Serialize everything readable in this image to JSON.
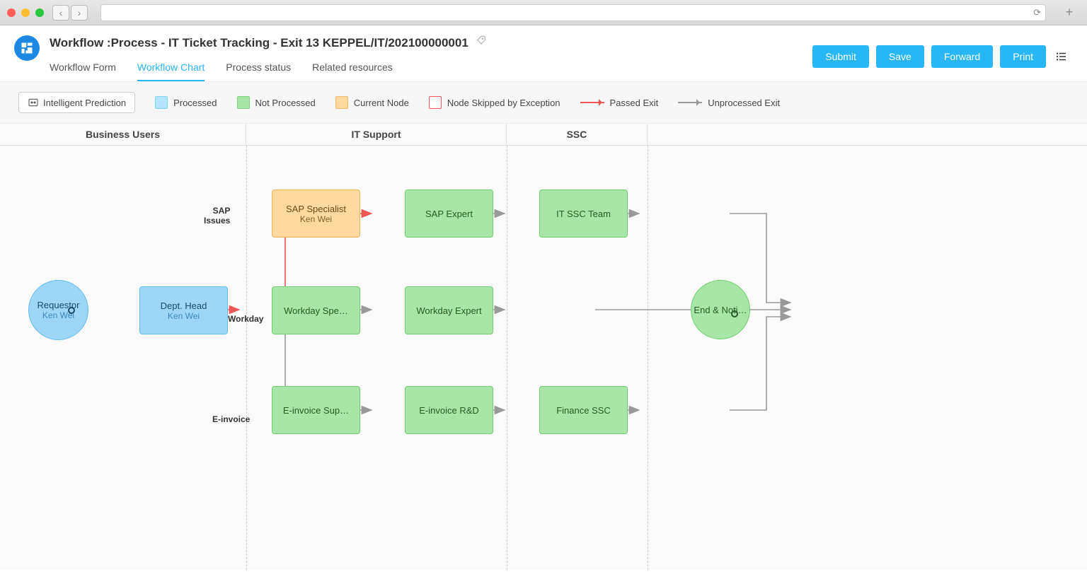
{
  "page_title": "Workflow :Process - IT Ticket Tracking - Exit 13 KEPPEL/IT/202100000001",
  "tabs": [
    "Workflow Form",
    "Workflow Chart",
    "Process status",
    "Related resources"
  ],
  "active_tab": "Workflow Chart",
  "actions": {
    "submit": "Submit",
    "save": "Save",
    "forward": "Forward",
    "print": "Print"
  },
  "prediction_btn": "Intelligent Prediction",
  "legend": {
    "processed": "Processed",
    "not_processed": "Not Processed",
    "current_node": "Current Node",
    "skipped": "Node Skipped by Exception",
    "passed_exit": "Passed Exit",
    "unprocessed_exit": "Unprocessed Exit"
  },
  "lanes": [
    "Business Users",
    "IT Support",
    "SSC"
  ],
  "chart_data": {
    "type": "flowchart",
    "swimlanes": {
      "Business Users": {
        "x_range": [
          0,
          348
        ]
      },
      "IT Support": {
        "x_range": [
          348,
          716
        ]
      },
      "SSC": {
        "x_range": [
          716,
          915
        ]
      }
    },
    "nodes": [
      {
        "id": "requestor",
        "label": "Requestor",
        "sub": "Ken Wei",
        "shape": "circle",
        "state": "processed",
        "lane": "Business Users",
        "is_start": true
      },
      {
        "id": "dept_head",
        "label": "Dept. Head",
        "sub": "Ken Wei",
        "shape": "rect",
        "state": "processed",
        "lane": "Business Users"
      },
      {
        "id": "sap_spec",
        "label": "SAP Specialist",
        "sub": "Ken Wei",
        "shape": "rect",
        "state": "current",
        "lane": "IT Support"
      },
      {
        "id": "sap_expert",
        "label": "SAP Expert",
        "shape": "rect",
        "state": "not_processed",
        "lane": "IT Support"
      },
      {
        "id": "workday_spec",
        "label": "Workday Spe…",
        "shape": "rect",
        "state": "not_processed",
        "lane": "IT Support"
      },
      {
        "id": "workday_expert",
        "label": "Workday Expert",
        "shape": "rect",
        "state": "not_processed",
        "lane": "IT Support"
      },
      {
        "id": "einv_sup",
        "label": "E-invoice Sup…",
        "shape": "rect",
        "state": "not_processed",
        "lane": "IT Support"
      },
      {
        "id": "einv_rd",
        "label": "E-invoice R&D",
        "shape": "rect",
        "state": "not_processed",
        "lane": "IT Support"
      },
      {
        "id": "it_ssc",
        "label": "IT SSC Team",
        "shape": "rect",
        "state": "not_processed",
        "lane": "SSC"
      },
      {
        "id": "fin_ssc",
        "label": "Finance SSC",
        "shape": "rect",
        "state": "not_processed",
        "lane": "SSC"
      },
      {
        "id": "end",
        "label": "End & Noti…",
        "shape": "circle",
        "state": "not_processed",
        "lane": "",
        "is_end": true
      }
    ],
    "edges": [
      {
        "from": "requestor",
        "to": "dept_head",
        "state": "passed"
      },
      {
        "from": "dept_head",
        "to": "sap_spec",
        "label": "SAP Issues",
        "state": "passed"
      },
      {
        "from": "dept_head",
        "to": "workday_spec",
        "label": "Workday",
        "state": "unprocessed"
      },
      {
        "from": "dept_head",
        "to": "einv_sup",
        "label": "E-invoice",
        "state": "unprocessed"
      },
      {
        "from": "sap_spec",
        "to": "sap_expert",
        "state": "unprocessed"
      },
      {
        "from": "sap_expert",
        "to": "it_ssc",
        "state": "unprocessed"
      },
      {
        "from": "it_ssc",
        "to": "end",
        "state": "unprocessed"
      },
      {
        "from": "workday_spec",
        "to": "workday_expert",
        "state": "unprocessed"
      },
      {
        "from": "workday_expert",
        "to": "end",
        "state": "unprocessed"
      },
      {
        "from": "einv_sup",
        "to": "einv_rd",
        "state": "unprocessed"
      },
      {
        "from": "einv_rd",
        "to": "fin_ssc",
        "state": "unprocessed"
      },
      {
        "from": "fin_ssc",
        "to": "end",
        "state": "unprocessed"
      }
    ]
  }
}
